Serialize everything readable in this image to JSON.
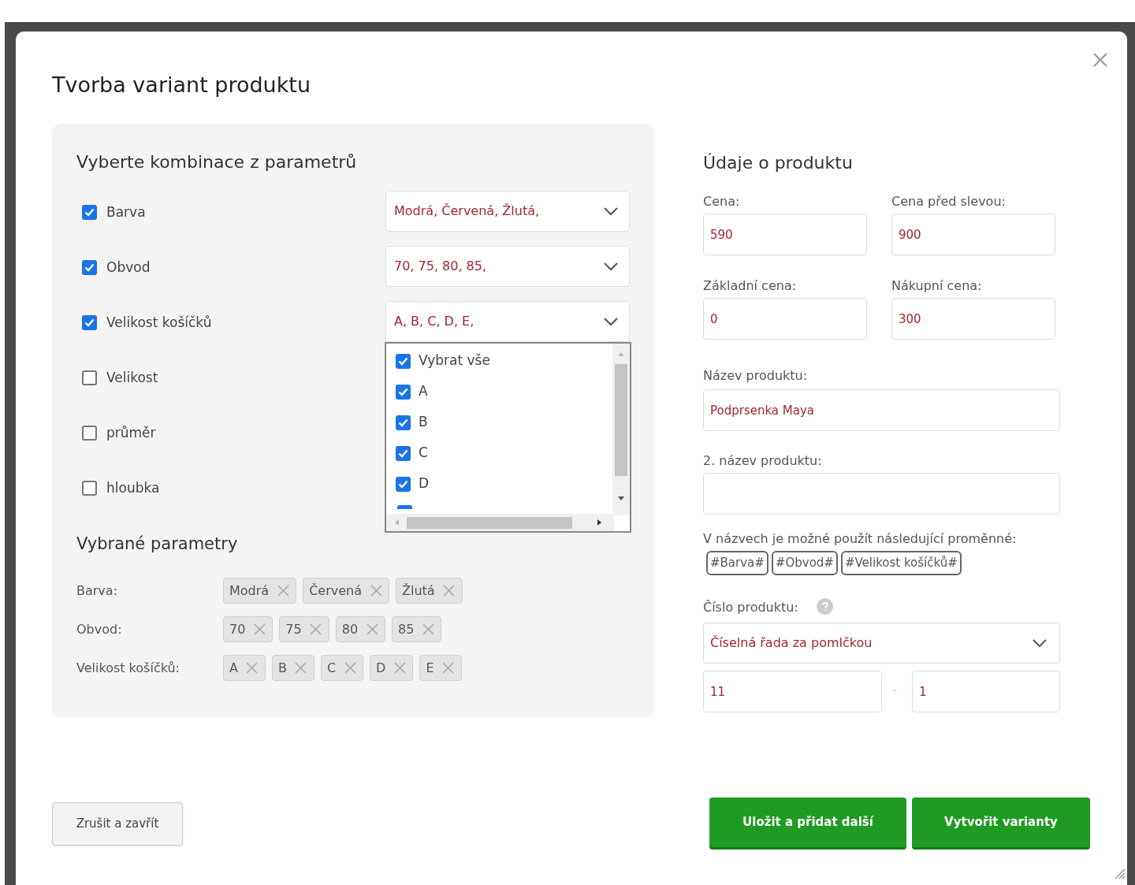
{
  "dialog": {
    "title": "Tvorba variant produktu"
  },
  "parameters_panel": {
    "heading": "Vyberte kombinace z parametrů",
    "parameters": [
      {
        "label": "Barva",
        "checked": true,
        "value": "Modrá, Červená, Žlutá,",
        "open": false
      },
      {
        "label": "Obvod",
        "checked": true,
        "value": "70, 75, 80, 85,",
        "open": false
      },
      {
        "label": "Velikost košíčků",
        "checked": true,
        "value": "A, B, C, D, E,",
        "open": true
      },
      {
        "label": "Velikost",
        "checked": false
      },
      {
        "label": "průměr",
        "checked": false
      },
      {
        "label": "hloubka",
        "checked": false
      }
    ],
    "dropdown_items": [
      {
        "label": "Vybrat vše",
        "checked": true
      },
      {
        "label": "A",
        "checked": true
      },
      {
        "label": "B",
        "checked": true
      },
      {
        "label": "C",
        "checked": true
      },
      {
        "label": "D",
        "checked": true
      }
    ],
    "dropdown_cut_off_item": {
      "checked": true
    },
    "selected_heading": "Vybrané parametry",
    "selected": [
      {
        "label": "Barva:",
        "tags": [
          "Modrá",
          "Červená",
          "Žlutá"
        ]
      },
      {
        "label": "Obvod:",
        "tags": [
          "70",
          "75",
          "80",
          "85"
        ]
      },
      {
        "label": "Velikost košíčků:",
        "tags": [
          "A",
          "B",
          "C",
          "D",
          "E"
        ]
      }
    ]
  },
  "product_panel": {
    "heading": "Údaje o produktu",
    "price": {
      "label": "Cena:",
      "value": "590"
    },
    "price_before_discount": {
      "label": "Cena před slevou:",
      "value": "900"
    },
    "base_price": {
      "label": "Základní cena:",
      "value": "0"
    },
    "purchase_price": {
      "label": "Nákupní cena:",
      "value": "300"
    },
    "name": {
      "label": "Název produktu:",
      "value": "Podprsenka Maya"
    },
    "second_name": {
      "label": "2. název produktu:"
    },
    "variables_hint": "V názvech je možné použít následující proměnné:",
    "variables": [
      "#Barva#",
      "#Obvod#",
      "#Velikost košíčků#"
    ],
    "product_number": {
      "label": "Číslo produktu:",
      "mode": "Číselná řada za pomlčkou",
      "prefix": "11",
      "separator": "-",
      "start": "1"
    }
  },
  "buttons": {
    "cancel": "Zrušit a zavřít",
    "save_and_add": "Uložit a přidat další",
    "create": "Vytvořit varianty"
  }
}
